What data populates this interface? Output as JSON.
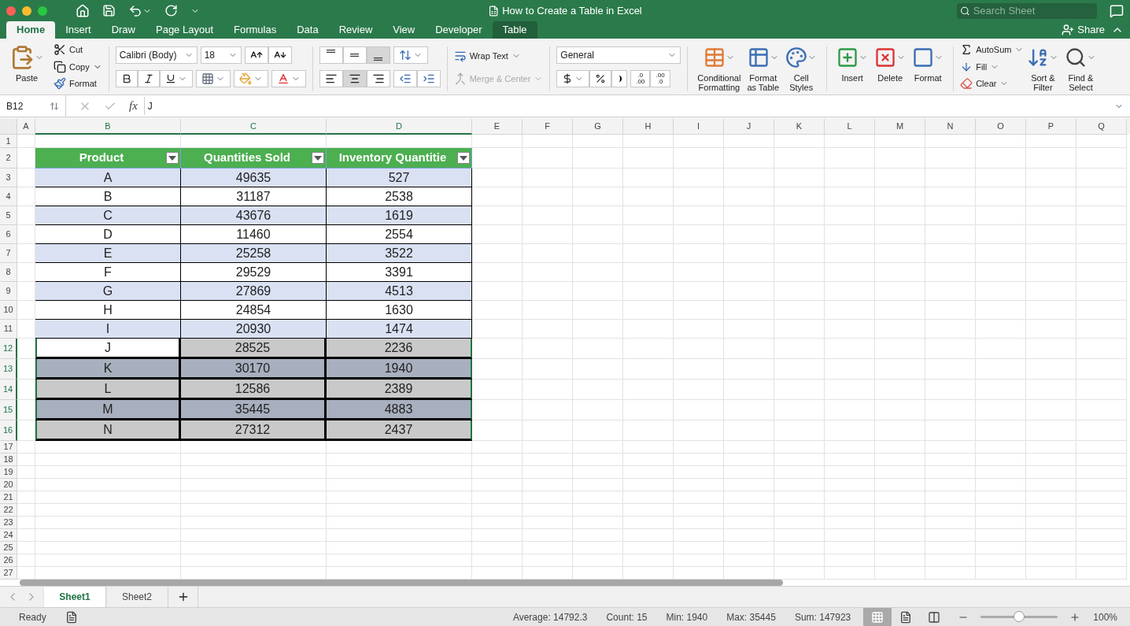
{
  "window": {
    "title": "How to Create a Table in Excel",
    "search_placeholder": "Search Sheet"
  },
  "ribbon_tabs": [
    {
      "label": "Home",
      "selected": true,
      "contextual": false
    },
    {
      "label": "Insert",
      "selected": false,
      "contextual": false
    },
    {
      "label": "Draw",
      "selected": false,
      "contextual": false
    },
    {
      "label": "Page Layout",
      "selected": false,
      "contextual": false
    },
    {
      "label": "Formulas",
      "selected": false,
      "contextual": false
    },
    {
      "label": "Data",
      "selected": false,
      "contextual": false
    },
    {
      "label": "Review",
      "selected": false,
      "contextual": false
    },
    {
      "label": "View",
      "selected": false,
      "contextual": false
    },
    {
      "label": "Developer",
      "selected": false,
      "contextual": false
    },
    {
      "label": "Table",
      "selected": false,
      "contextual": true
    }
  ],
  "share": "Share",
  "ribbon": {
    "clipboard": {
      "paste": "Paste",
      "cut": "Cut",
      "copy": "Copy",
      "format": "Format"
    },
    "font": {
      "name": "Calibri (Body)",
      "size": "18"
    },
    "vertical_align": [
      {
        "kind": "top",
        "selected": false
      },
      {
        "kind": "middle",
        "selected": false
      },
      {
        "kind": "bottom",
        "selected": true
      }
    ],
    "horizontal_align": [
      {
        "kind": "left",
        "selected": false
      },
      {
        "kind": "center",
        "selected": true
      },
      {
        "kind": "right",
        "selected": false
      }
    ],
    "wrap_text": "Wrap Text",
    "merge": {
      "label": "Merge & Center",
      "disabled": true
    },
    "number_format": "General",
    "decimals": [
      {
        "top": ".0",
        "bottom": ".00"
      },
      {
        "top": ".00",
        "bottom": ".0"
      }
    ],
    "styles": [
      "Conditional\nFormatting",
      "Format\nas Table",
      "Cell\nStyles"
    ],
    "cells": [
      "Insert",
      "Delete",
      "Format"
    ],
    "editing": {
      "autosum": "AutoSum",
      "fill": "Fill",
      "clear": "Clear",
      "sort": "Sort &\nFilter",
      "find": "Find &\nSelect"
    }
  },
  "formula_bar": {
    "name_box": "B12",
    "function_label": "fx",
    "formula": "J"
  },
  "sheet": {
    "columns": [
      {
        "label": "A",
        "selected": false
      },
      {
        "label": "B",
        "selected": true
      },
      {
        "label": "C",
        "selected": true
      },
      {
        "label": "D",
        "selected": true
      },
      {
        "label": "E",
        "selected": false
      },
      {
        "label": "F",
        "selected": false
      },
      {
        "label": "G",
        "selected": false
      },
      {
        "label": "H",
        "selected": false
      },
      {
        "label": "I",
        "selected": false
      },
      {
        "label": "J",
        "selected": false
      },
      {
        "label": "K",
        "selected": false
      },
      {
        "label": "L",
        "selected": false
      },
      {
        "label": "M",
        "selected": false
      },
      {
        "label": "N",
        "selected": false
      },
      {
        "label": "O",
        "selected": false
      },
      {
        "label": "P",
        "selected": false
      },
      {
        "label": "Q",
        "selected": false
      }
    ],
    "rows": [
      {
        "number": "1",
        "selected": false,
        "kind": "empty"
      },
      {
        "number": "2",
        "selected": false,
        "kind": "header",
        "cells": [
          {
            "text": "Product"
          },
          {
            "text": "Quantities Sold"
          },
          {
            "text": "Inventory Quantitie"
          }
        ]
      },
      {
        "number": "3",
        "selected": false,
        "kind": "data",
        "cells": [
          {
            "text": "A",
            "kind": "banded"
          },
          {
            "text": "49635",
            "kind": "banded"
          },
          {
            "text": "527",
            "kind": "banded"
          }
        ]
      },
      {
        "number": "4",
        "selected": false,
        "kind": "data",
        "cells": [
          {
            "text": "B",
            "kind": "plain"
          },
          {
            "text": "31187",
            "kind": "plain"
          },
          {
            "text": "2538",
            "kind": "plain"
          }
        ]
      },
      {
        "number": "5",
        "selected": false,
        "kind": "data",
        "cells": [
          {
            "text": "C",
            "kind": "banded"
          },
          {
            "text": "43676",
            "kind": "banded"
          },
          {
            "text": "1619",
            "kind": "banded"
          }
        ]
      },
      {
        "number": "6",
        "selected": false,
        "kind": "data",
        "cells": [
          {
            "text": "D",
            "kind": "plain"
          },
          {
            "text": "11460",
            "kind": "plain"
          },
          {
            "text": "2554",
            "kind": "plain"
          }
        ]
      },
      {
        "number": "7",
        "selected": false,
        "kind": "data",
        "cells": [
          {
            "text": "E",
            "kind": "banded"
          },
          {
            "text": "25258",
            "kind": "banded"
          },
          {
            "text": "3522",
            "kind": "banded"
          }
        ]
      },
      {
        "number": "8",
        "selected": false,
        "kind": "data",
        "cells": [
          {
            "text": "F",
            "kind": "plain"
          },
          {
            "text": "29529",
            "kind": "plain"
          },
          {
            "text": "3391",
            "kind": "plain"
          }
        ]
      },
      {
        "number": "9",
        "selected": false,
        "kind": "data",
        "cells": [
          {
            "text": "G",
            "kind": "banded"
          },
          {
            "text": "27869",
            "kind": "banded"
          },
          {
            "text": "4513",
            "kind": "banded"
          }
        ]
      },
      {
        "number": "10",
        "selected": false,
        "kind": "data",
        "cells": [
          {
            "text": "H",
            "kind": "plain"
          },
          {
            "text": "24854",
            "kind": "plain"
          },
          {
            "text": "1630",
            "kind": "plain"
          }
        ]
      },
      {
        "number": "11",
        "selected": false,
        "kind": "data",
        "cells": [
          {
            "text": "I",
            "kind": "banded"
          },
          {
            "text": "20930",
            "kind": "banded"
          },
          {
            "text": "1474",
            "kind": "banded"
          }
        ]
      },
      {
        "number": "12",
        "selected": true,
        "kind": "data",
        "cells": [
          {
            "text": "J",
            "kind": "plain"
          },
          {
            "text": "28525",
            "kind": "gray"
          },
          {
            "text": "2236",
            "kind": "gray"
          }
        ]
      },
      {
        "number": "13",
        "selected": true,
        "kind": "data",
        "cells": [
          {
            "text": "K",
            "kind": "slate"
          },
          {
            "text": "30170",
            "kind": "slate"
          },
          {
            "text": "1940",
            "kind": "slate"
          }
        ]
      },
      {
        "number": "14",
        "selected": true,
        "kind": "data",
        "cells": [
          {
            "text": "L",
            "kind": "gray"
          },
          {
            "text": "12586",
            "kind": "gray"
          },
          {
            "text": "2389",
            "kind": "gray"
          }
        ]
      },
      {
        "number": "15",
        "selected": true,
        "kind": "data",
        "cells": [
          {
            "text": "M",
            "kind": "slate"
          },
          {
            "text": "35445",
            "kind": "slate"
          },
          {
            "text": "4883",
            "kind": "slate"
          }
        ]
      },
      {
        "number": "16",
        "selected": true,
        "kind": "data",
        "cells": [
          {
            "text": "N",
            "kind": "gray"
          },
          {
            "text": "27312",
            "kind": "gray"
          },
          {
            "text": "2437",
            "kind": "gray"
          }
        ]
      },
      {
        "number": "17",
        "selected": false,
        "kind": "empty"
      },
      {
        "number": "18",
        "selected": false,
        "kind": "empty"
      },
      {
        "number": "19",
        "selected": false,
        "kind": "empty"
      },
      {
        "number": "20",
        "selected": false,
        "kind": "empty"
      },
      {
        "number": "21",
        "selected": false,
        "kind": "empty"
      },
      {
        "number": "22",
        "selected": false,
        "kind": "empty"
      },
      {
        "number": "23",
        "selected": false,
        "kind": "empty"
      },
      {
        "number": "24",
        "selected": false,
        "kind": "empty"
      },
      {
        "number": "25",
        "selected": false,
        "kind": "empty"
      },
      {
        "number": "26",
        "selected": false,
        "kind": "empty"
      },
      {
        "number": "27",
        "selected": false,
        "kind": "empty"
      }
    ]
  },
  "sheet_tabs": [
    {
      "label": "Sheet1",
      "selected": true
    },
    {
      "label": "Sheet2",
      "selected": false
    }
  ],
  "status_bar": {
    "mode": "Ready",
    "stats": [
      "Average: 14792.3",
      "Count: 15",
      "Min: 1940",
      "Max: 35445",
      "Sum: 147923"
    ],
    "views": [
      {
        "kind": "normal",
        "selected": true
      },
      {
        "kind": "page_layout",
        "selected": false
      },
      {
        "kind": "page_break",
        "selected": false
      }
    ],
    "zoom": {
      "level": 0.5,
      "label": "100%"
    }
  }
}
